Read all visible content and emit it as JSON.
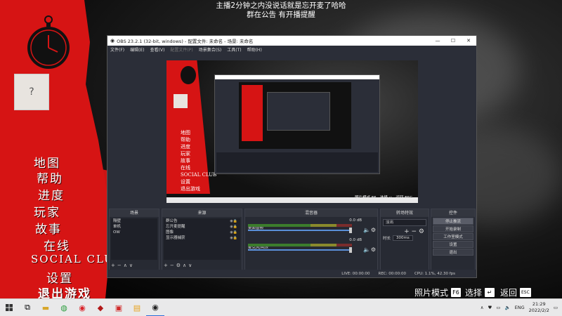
{
  "stream_overlay": {
    "line1": "主播2分钟之内没说话就是忘开麦了哈哈",
    "line2": "群在公告 有开播提醒"
  },
  "game_menu": {
    "items": [
      "地图",
      "帮助",
      "进度",
      "玩家",
      "故事",
      "在线",
      "SOCIAL CLUB",
      "设置",
      "退出游戏"
    ]
  },
  "obs": {
    "title": "OBS 23.2.1 (32-bit, windows) - 配置文件: 未命名 - 场景: 未命名",
    "menu": [
      "文件(F)",
      "编辑(E)",
      "查看(V)",
      "配置文件(P)",
      "场景集合(S)",
      "工具(T)",
      "帮助(H)"
    ],
    "panels": {
      "scenes": {
        "title": "场景",
        "items": [
          "隔壁",
          "单机",
          "OW"
        ]
      },
      "sources": {
        "title": "来源",
        "items": [
          "群公告",
          "忘开麦提醒",
          "图像",
          "显示器捕获"
        ]
      },
      "mixer": {
        "title": "混音器",
        "tracks": [
          {
            "name": "桌面音频",
            "db": "0.0 dB"
          },
          {
            "name": "麦克风/Aux",
            "db": "0.0 dB"
          }
        ]
      },
      "transitions": {
        "title": "转场特效",
        "type": "淡出",
        "duration_label": "时长",
        "duration": "300ms"
      },
      "controls": {
        "title": "控件",
        "buttons": [
          "停止推流",
          "开始录制",
          "工作室模式",
          "设置",
          "退出"
        ]
      }
    },
    "status": {
      "live": "LIVE: 00:00:00",
      "rec": "REC: 00:00:00",
      "cpu": "CPU: 1.1%, 42.30 fps"
    }
  },
  "hints": [
    {
      "label": "照片模式",
      "key": "F6"
    },
    {
      "label": "选择",
      "key": "↵"
    },
    {
      "label": "返回",
      "key": "ESC"
    }
  ],
  "taskbar": {
    "lang": "ENG",
    "time": "21:29",
    "date": "2022/2/2"
  }
}
